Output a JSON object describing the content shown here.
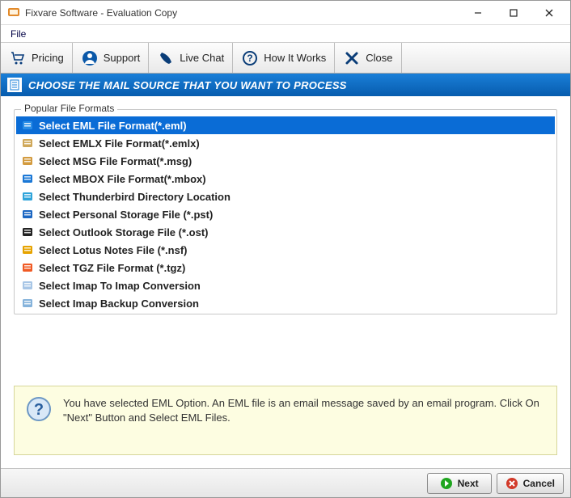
{
  "window": {
    "title": "Fixvare Software - Evaluation Copy"
  },
  "menubar": {
    "file_label": "File"
  },
  "toolbar": {
    "pricing_label": "Pricing",
    "support_label": "Support",
    "livechat_label": "Live Chat",
    "howitworks_label": "How It Works",
    "close_label": "Close"
  },
  "section": {
    "header": "CHOOSE THE MAIL SOURCE THAT YOU WANT TO PROCESS"
  },
  "formats": {
    "legend": "Popular File Formats",
    "items": [
      {
        "label": "Select EML File Format(*.eml)",
        "icon": "eml",
        "selected": true
      },
      {
        "label": "Select EMLX File Format(*.emlx)",
        "icon": "emlx",
        "selected": false
      },
      {
        "label": "Select MSG File Format(*.msg)",
        "icon": "msg",
        "selected": false
      },
      {
        "label": "Select MBOX File Format(*.mbox)",
        "icon": "mbox",
        "selected": false
      },
      {
        "label": "Select Thunderbird Directory Location",
        "icon": "thunderbird",
        "selected": false
      },
      {
        "label": "Select Personal Storage File (*.pst)",
        "icon": "pst",
        "selected": false
      },
      {
        "label": "Select Outlook Storage File (*.ost)",
        "icon": "ost",
        "selected": false
      },
      {
        "label": "Select Lotus Notes File (*.nsf)",
        "icon": "nsf",
        "selected": false
      },
      {
        "label": "Select TGZ File Format (*.tgz)",
        "icon": "tgz",
        "selected": false
      },
      {
        "label": "Select Imap To Imap Conversion",
        "icon": "imap",
        "selected": false
      },
      {
        "label": "Select Imap Backup Conversion",
        "icon": "imap-backup",
        "selected": false
      }
    ]
  },
  "info": {
    "text": "You have selected EML Option. An EML file is an email message saved by an email program. Click On \"Next\" Button and Select EML Files."
  },
  "footer": {
    "next_label": "Next",
    "cancel_label": "Cancel"
  },
  "icon_colors": {
    "eml": "#2a8de6",
    "emlx": "#cfa85a",
    "msg": "#d39b3f",
    "mbox": "#1b78d6",
    "thunderbird": "#2fa4da",
    "pst": "#1b66c2",
    "ost": "#222222",
    "nsf": "#e6a300",
    "tgz": "#f05a24",
    "imap": "#a8c6e6",
    "imap-backup": "#86b3db"
  }
}
